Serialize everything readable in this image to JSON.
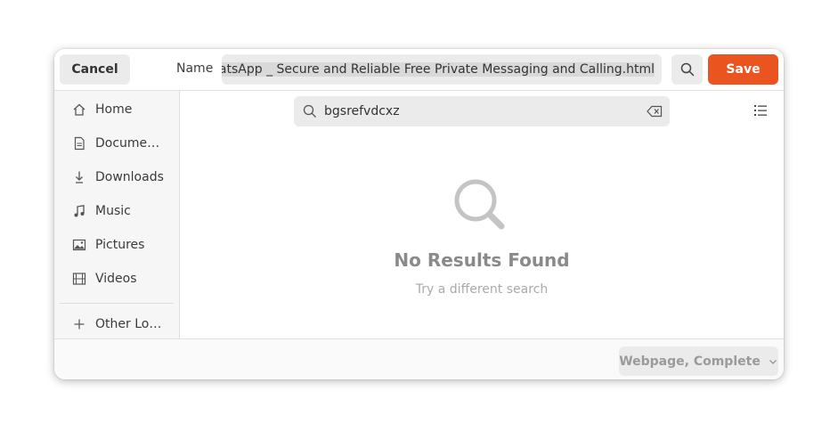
{
  "header": {
    "cancel_label": "Cancel",
    "name_label": "Name",
    "filename_value": "WhatsApp _ Secure and Reliable Free Private Messaging and Calling.html",
    "save_label": "Save",
    "search_icon": "search-icon"
  },
  "sidebar": {
    "items": [
      {
        "label": "Home",
        "icon": "home-icon"
      },
      {
        "label": "Docume…",
        "icon": "document-icon"
      },
      {
        "label": "Downloads",
        "icon": "download-icon"
      },
      {
        "label": "Music",
        "icon": "music-icon"
      },
      {
        "label": "Pictures",
        "icon": "picture-icon"
      },
      {
        "label": "Videos",
        "icon": "video-icon"
      }
    ],
    "other_locations": {
      "label": "Other Lo…",
      "icon": "plus-icon"
    }
  },
  "search": {
    "query": "bgsrefvdcxz",
    "clear_icon": "clear-text-icon"
  },
  "empty_state": {
    "title": "No Results Found",
    "subtitle": "Try a different search"
  },
  "footer": {
    "file_type": "Webpage, Complete"
  },
  "colors": {
    "accent": "#e95420",
    "button_bg": "#ebebeb",
    "sidebar_bg": "#f6f6f6"
  }
}
